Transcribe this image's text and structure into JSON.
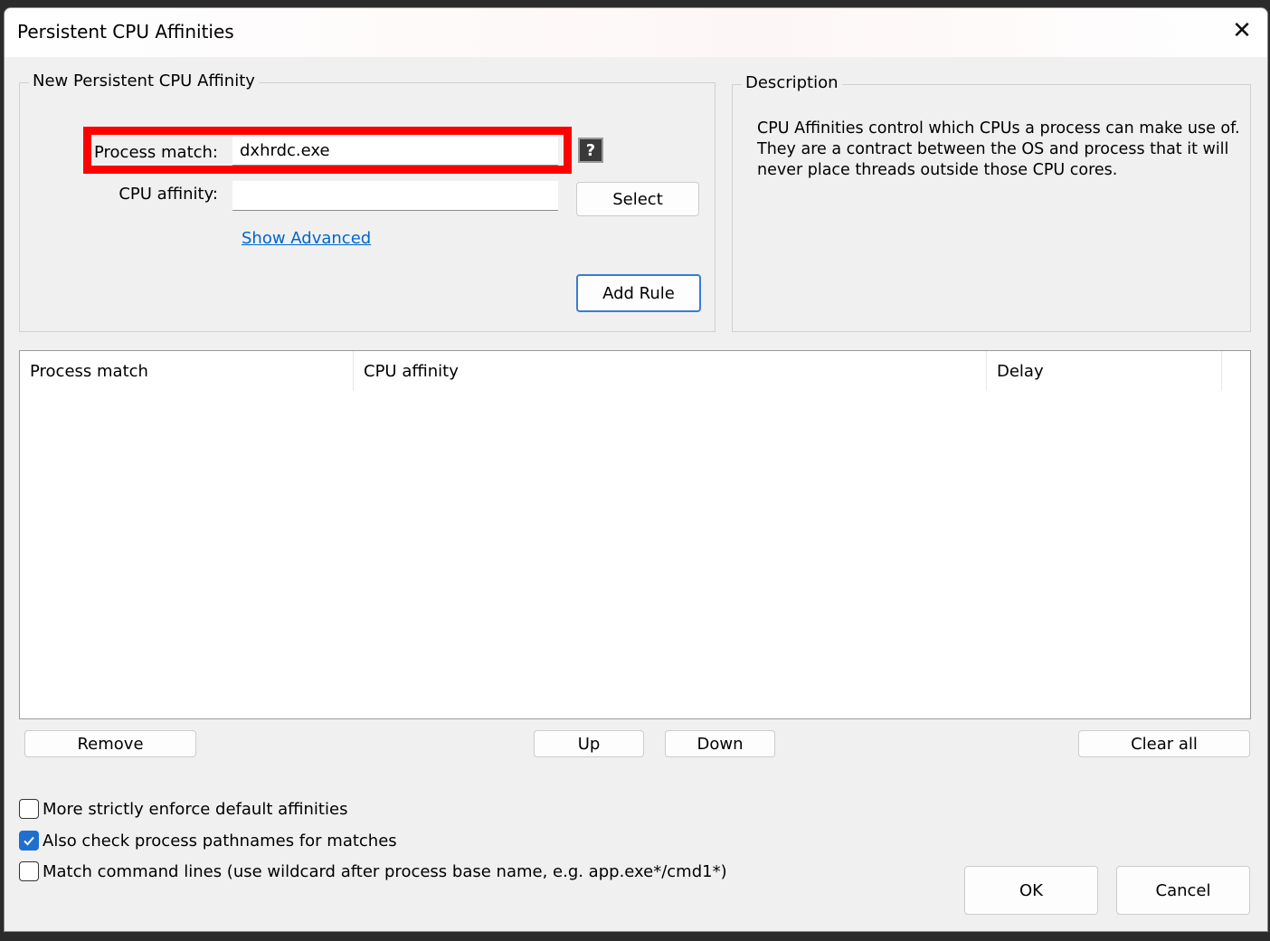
{
  "window": {
    "title": "Persistent CPU Affinities",
    "close_glyph": "✕"
  },
  "new_affinity": {
    "group_label": "New Persistent CPU Affinity",
    "process_match_label": "Process match:",
    "process_match_value": "dxhrdc.exe",
    "cpu_affinity_label": "CPU affinity:",
    "cpu_affinity_value": "",
    "help_glyph": "?",
    "select_label": "Select",
    "show_advanced_label": "Show Advanced",
    "add_rule_label": "Add Rule"
  },
  "description": {
    "group_label": "Description",
    "text": "CPU Affinities control which CPUs a process can make use of. They are a contract between the OS and process that it will never place threads outside those CPU cores."
  },
  "rules_table": {
    "columns": [
      "Process match",
      "CPU affinity",
      "Delay"
    ],
    "rows": []
  },
  "list_buttons": {
    "remove": "Remove",
    "up": "Up",
    "down": "Down",
    "clear_all": "Clear all"
  },
  "options": [
    {
      "label": "More strictly enforce default affinities",
      "checked": false
    },
    {
      "label": "Also check process pathnames for matches",
      "checked": true
    },
    {
      "label": "Match command lines (use wildcard after process base name, e.g. app.exe*/cmd1*)",
      "checked": false
    }
  ],
  "dialog_buttons": {
    "ok": "OK",
    "cancel": "Cancel"
  },
  "colors": {
    "accent": "#1f6fd1",
    "highlight": "#ff0000",
    "link": "#0066cc"
  }
}
